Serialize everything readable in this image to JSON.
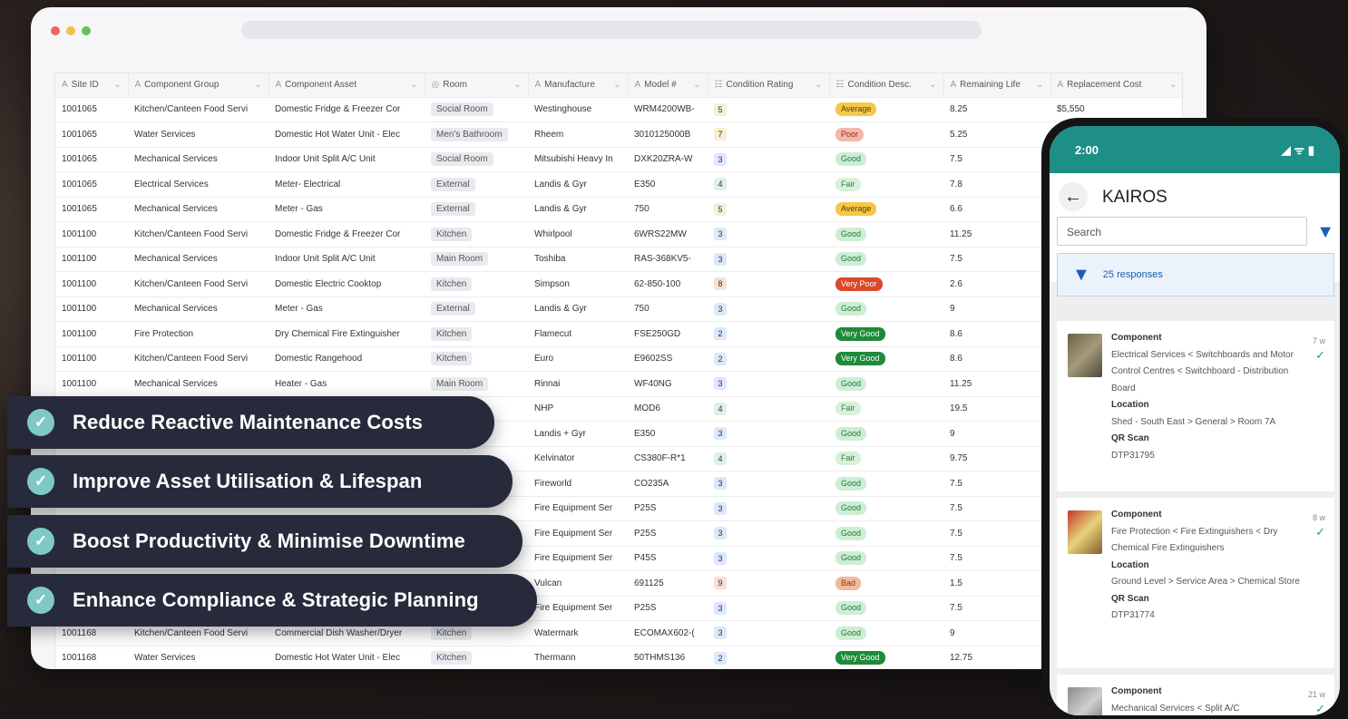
{
  "table": {
    "columns": [
      {
        "icon": "A",
        "label": "Site ID"
      },
      {
        "icon": "A",
        "label": "Component Group"
      },
      {
        "icon": "A",
        "label": "Component Asset"
      },
      {
        "icon": "◎",
        "label": "Room"
      },
      {
        "icon": "A",
        "label": "Manufacture"
      },
      {
        "icon": "A",
        "label": "Model #"
      },
      {
        "icon": "☷",
        "label": "Condition Rating"
      },
      {
        "icon": "☷",
        "label": "Condition Desc."
      },
      {
        "icon": "A",
        "label": "Remaining Life"
      },
      {
        "icon": "A",
        "label": "Replacement Cost"
      }
    ],
    "rows": [
      [
        "1001065",
        "Kitchen/Canteen Food Servi",
        "Domestic Fridge & Freezer Cor",
        "Social Room",
        "Westinghouse",
        "WRM4200WB-",
        "5",
        "Average",
        "8.25",
        "$5,550"
      ],
      [
        "1001065",
        "Water Services",
        "Domestic Hot Water Unit - Elec",
        "Men's Bathroom",
        "Rheem",
        "3010125000B",
        "7",
        "Poor",
        "5.25",
        ""
      ],
      [
        "1001065",
        "Mechanical Services",
        "Indoor Unit Split A/C Unit",
        "Social Room",
        "Mitsubishi Heavy In",
        "DXK20ZRA-W",
        "3",
        "Good",
        "7.5",
        ""
      ],
      [
        "1001065",
        "Electrical Services",
        "Meter- Electrical",
        "External",
        "Landis & Gyr",
        "E350",
        "4",
        "Fair",
        "7.8",
        ""
      ],
      [
        "1001065",
        "Mechanical Services",
        "Meter - Gas",
        "External",
        "Landis & Gyr",
        "750",
        "5",
        "Average",
        "6.6",
        ""
      ],
      [
        "1001100",
        "Kitchen/Canteen Food Servi",
        "Domestic Fridge & Freezer Cor",
        "Kitchen",
        "Whirlpool",
        "6WRS22MW",
        "3",
        "Good",
        "11.25",
        ""
      ],
      [
        "1001100",
        "Mechanical Services",
        "Indoor Unit Split A/C Unit",
        "Main Room",
        "Toshiba",
        "RAS-368KV5-",
        "3",
        "Good",
        "7.5",
        ""
      ],
      [
        "1001100",
        "Kitchen/Canteen Food Servi",
        "Domestic Electric Cooktop",
        "Kitchen",
        "Simpson",
        "62-850-100",
        "8",
        "Very Poor",
        "2.6",
        ""
      ],
      [
        "1001100",
        "Mechanical Services",
        "Meter - Gas",
        "External",
        "Landis & Gyr",
        "750",
        "3",
        "Good",
        "9",
        ""
      ],
      [
        "1001100",
        "Fire Protection",
        "Dry Chemical Fire Extinguisher",
        "Kitchen",
        "Flamecut",
        "FSE250GD",
        "2",
        "Very Good",
        "8.6",
        ""
      ],
      [
        "1001100",
        "Kitchen/Canteen Food Servi",
        "Domestic Rangehood",
        "Kitchen",
        "Euro",
        "E9602SS",
        "2",
        "Very Good",
        "8.6",
        ""
      ],
      [
        "1001100",
        "Mechanical Services",
        "Heater - Gas",
        "Main Room",
        "Rinnai",
        "WF40NG",
        "3",
        "Good",
        "11.25",
        ""
      ],
      [
        "",
        "",
        "",
        "",
        "NHP",
        "MOD6",
        "4",
        "Fair",
        "19.5",
        ""
      ],
      [
        "",
        "",
        "",
        "",
        "Landis + Gyr",
        "E350",
        "3",
        "Good",
        "9",
        ""
      ],
      [
        "",
        "",
        "",
        "",
        "Kelvinator",
        "CS380F-R*1",
        "4",
        "Fair",
        "9.75",
        ""
      ],
      [
        "",
        "",
        "",
        "",
        "Fireworld",
        "CO235A",
        "3",
        "Good",
        "7.5",
        ""
      ],
      [
        "",
        "",
        "",
        "",
        "Fire Equipment Ser",
        "P25S",
        "3",
        "Good",
        "7.5",
        ""
      ],
      [
        "",
        "",
        "",
        "",
        "Fire Equipment Ser",
        "P25S",
        "3",
        "Good",
        "7.5",
        ""
      ],
      [
        "",
        "",
        "",
        "",
        "Fire Equipment Ser",
        "P45S",
        "3",
        "Good",
        "7.5",
        ""
      ],
      [
        "",
        "",
        "",
        "",
        "Vulcan",
        "691125",
        "9",
        "Bad",
        "1.5",
        ""
      ],
      [
        "",
        "",
        "",
        "",
        "Fire Equipment Ser",
        "P25S",
        "3",
        "Good",
        "7.5",
        ""
      ],
      [
        "1001168",
        "Kitchen/Canteen Food Servi",
        "Commercial Dish Washer/Dryer",
        "Kitchen",
        "Watermark",
        "ECOMAX602-(",
        "3",
        "Good",
        "9",
        ""
      ],
      [
        "1001168",
        "Water Services",
        "Domestic Hot Water Unit - Elec",
        "Kitchen",
        "Thermann",
        "50THMS136",
        "2",
        "Very Good",
        "12.75",
        ""
      ]
    ]
  },
  "benefits": [
    "Reduce Reactive Maintenance Costs",
    "Improve Asset Utilisation & Lifespan",
    "Boost Productivity & Minimise Downtime",
    "Enhance Compliance & Strategic Planning"
  ],
  "phone": {
    "time": "2:00",
    "status_icons": "◢ ᯤ ▮",
    "app_title": "KAIROS",
    "search_placeholder": "Search",
    "responses_label": "25 responses",
    "cards": [
      {
        "component_label": "Component",
        "component": "Electrical Services < Switchboards and Motor Control Centres < Switchboard - Distribution Board",
        "location_label": "Location",
        "location": "Shed - South East > General > Room 7A",
        "qr_label": "QR Scan",
        "qr": "DTP31795",
        "meta": "7 w"
      },
      {
        "component_label": "Component",
        "component": "Fire Protection < Fire Extinguishers < Dry Chemical Fire Extinguishers",
        "location_label": "Location",
        "location": "Ground Level > Service Area > Chemical Store",
        "qr_label": "QR Scan",
        "qr": "DTP31774",
        "meta": "8 w"
      },
      {
        "component_label": "Component",
        "component": "Mechanical Services < Split A/C",
        "meta": "21 w"
      }
    ]
  },
  "colors": {
    "rating": {
      "2": "#dce8fb",
      "3": "#dce8fb",
      "4": "#ddf2e6",
      "5": "#e8f6d9",
      "7": "#fdeccd",
      "8": "#fbe0d2",
      "9": "#f9dcdc"
    },
    "desc": {
      "Average": [
        "#f6c84a",
        "#5a3d00"
      ],
      "Poor": [
        "#f5b7a8",
        "#8a2e18"
      ],
      "Good": [
        "#cdeed5",
        "#1f7a38"
      ],
      "Fair": [
        "#d9f0dc",
        "#3a7a44"
      ],
      "Very Poor": [
        "#d94a2b",
        "#ffffff"
      ],
      "Very Good": [
        "#1f8a3a",
        "#ffffff"
      ],
      "Bad": [
        "#f3b99b",
        "#8a3a10"
      ]
    }
  }
}
